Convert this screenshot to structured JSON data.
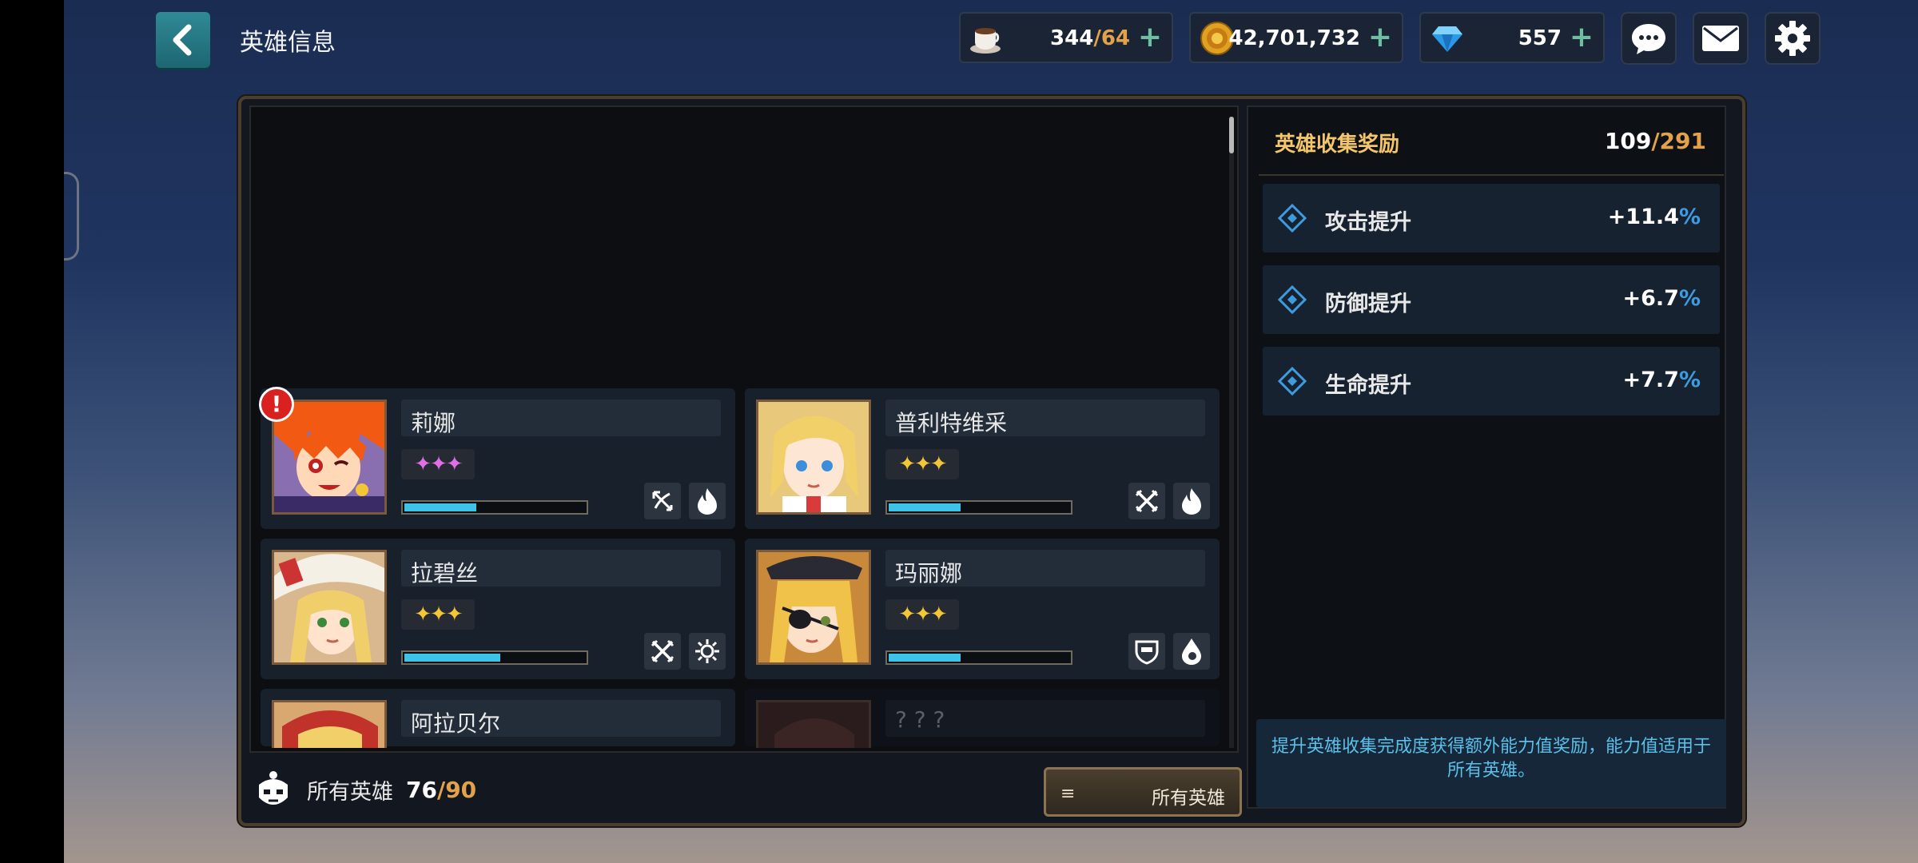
{
  "header": {
    "title": "英雄信息",
    "resources": [
      {
        "name": "coffee",
        "value": "344",
        "max": "64"
      },
      {
        "name": "gold",
        "value": "42,701,732"
      },
      {
        "name": "gem",
        "value": "557"
      }
    ],
    "plus_glyph": "+"
  },
  "heroes": [
    {
      "name": "莉娜",
      "stars": "✦✦✦",
      "star_color": "purple",
      "progress": 0.4,
      "badges": [
        "bow-icon",
        "fire-icon"
      ],
      "alert": "!"
    },
    {
      "name": "普利特维采",
      "stars": "✦✦✦",
      "star_color": "gold",
      "progress": 0.4,
      "badges": [
        "crossed-swords-icon",
        "fire-icon"
      ]
    },
    {
      "name": "拉碧丝",
      "stars": "✦✦✦",
      "star_color": "gold",
      "progress": 0.53,
      "badges": [
        "crossed-swords-icon",
        "sun-icon"
      ]
    },
    {
      "name": "玛丽娜",
      "stars": "✦✦✦",
      "star_color": "gold",
      "progress": 0.4,
      "badges": [
        "shield-icon",
        "water-icon"
      ]
    },
    {
      "name": "阿拉贝尔"
    },
    {
      "name": "? ? ?",
      "locked": true
    }
  ],
  "footer": {
    "all_heroes_label": "所有英雄",
    "owned": "76",
    "total": "90",
    "filter_label": "所有英雄",
    "filter_icon": "≡"
  },
  "reward": {
    "title": "英雄收集奖励",
    "collected": "109",
    "total": "291",
    "stats": [
      {
        "label": "攻击提升",
        "value": "+11.4",
        "unit": "%"
      },
      {
        "label": "防御提升",
        "value": "+6.7",
        "unit": "%"
      },
      {
        "label": "生命提升",
        "value": "+7.7",
        "unit": "%"
      }
    ],
    "info": "提升英雄收集完成度获得额外能力值奖励，能力值适用于所有英雄。"
  },
  "colors": {
    "accent_gold": "#e3a24a",
    "bar_fill": "#3ec3e8",
    "pct_blue": "#3d9be0"
  }
}
